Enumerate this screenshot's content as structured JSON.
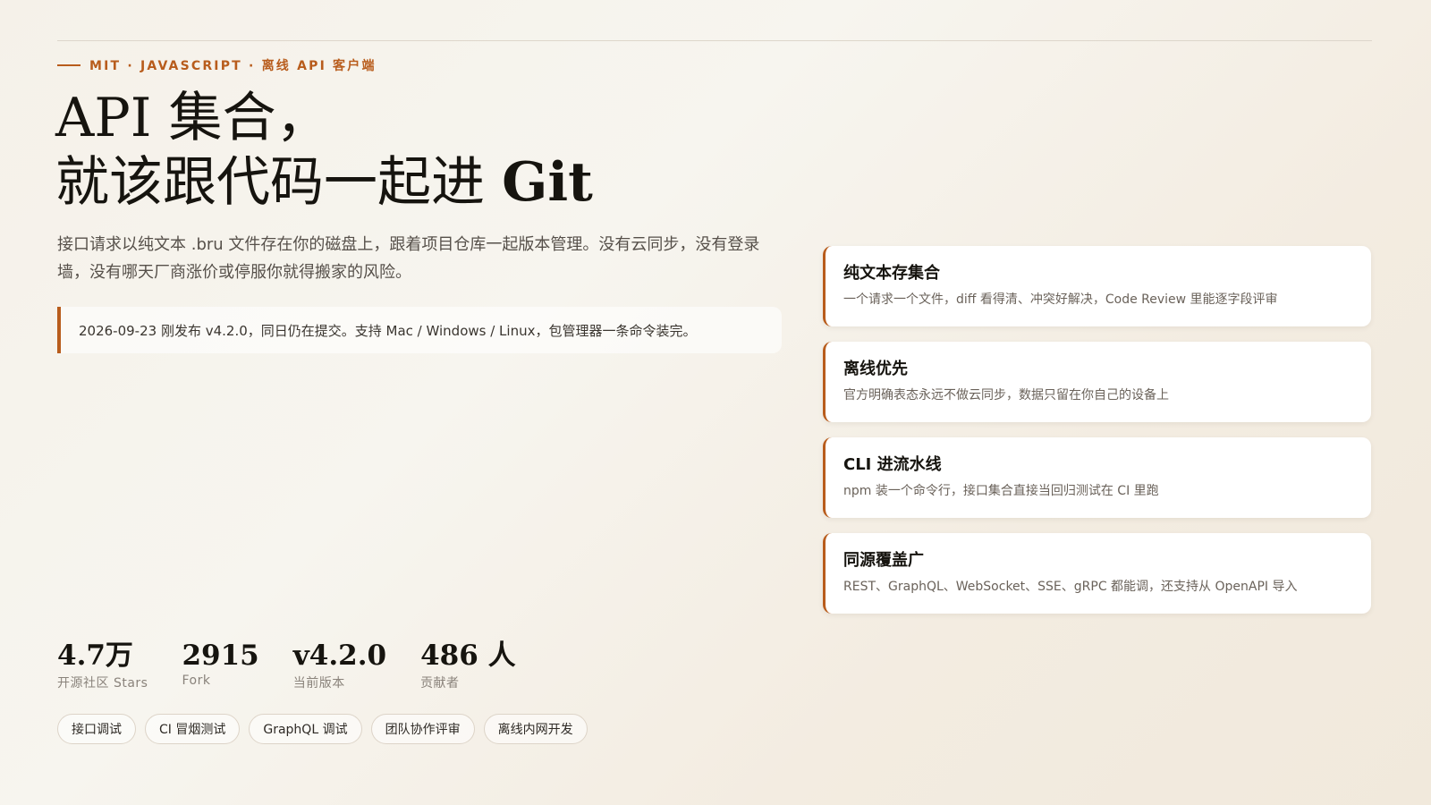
{
  "eyebrow": {
    "text": "MIT · JAVASCRIPT · 离线 API 客户端"
  },
  "hero": {
    "title_line1": "API 集合，",
    "title_line2_prefix": "就该跟代码一起进 ",
    "title_line2_emph": "Git",
    "lead": "接口请求以纯文本 .bru 文件存在你的磁盘上，跟着项目仓库一起版本管理。没有云同步，没有登录墙，没有哪天厂商涨价或停服你就得搬家的风险。",
    "notice": "2026-09-23 刚发布 v4.2.0，同日仍在提交。支持 Mac / Windows / Linux，包管理器一条命令装完。"
  },
  "features": [
    {
      "title": "纯文本存集合",
      "desc": "一个请求一个文件，diff 看得清、冲突好解决，Code Review 里能逐字段评审"
    },
    {
      "title": "离线优先",
      "desc": "官方明确表态永远不做云同步，数据只留在你自己的设备上"
    },
    {
      "title": "CLI 进流水线",
      "desc": "npm 装一个命令行，接口集合直接当回归测试在 CI 里跑"
    },
    {
      "title": "同源覆盖广",
      "desc": "REST、GraphQL、WebSocket、SSE、gRPC 都能调，还支持从 OpenAPI 导入"
    }
  ],
  "stats": [
    {
      "value": "4.7万",
      "label": "开源社区 Stars"
    },
    {
      "value": "2915",
      "label": "Fork"
    },
    {
      "value": "v4.2.0",
      "label": "当前版本"
    },
    {
      "value": "486 人",
      "label": "贡献者"
    }
  ],
  "tags": [
    "接口调试",
    "CI 冒烟测试",
    "GraphQL 调试",
    "团队协作评审",
    "离线内网开发"
  ],
  "colors": {
    "accent": "#b85c1c",
    "text": "#16140f",
    "muted": "#6a625a",
    "background": "#f6f3ec"
  }
}
